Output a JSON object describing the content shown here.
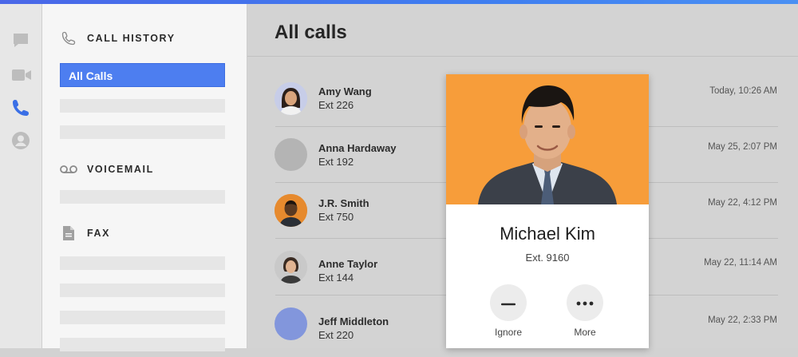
{
  "rail": {
    "icons": [
      "chat-icon",
      "video-icon",
      "phone-icon",
      "profile-icon"
    ]
  },
  "nav": {
    "call_history_title": "CALL HISTORY",
    "all_calls_label": "All Calls",
    "voicemail_title": "VOICEMAIL",
    "fax_title": "FAX"
  },
  "main": {
    "title": "All calls",
    "calls": [
      {
        "name": "Amy Wang",
        "ext": "Ext 226",
        "time": "Today, 10:26 AM"
      },
      {
        "name": "Anna Hardaway",
        "ext": "Ext 192",
        "time": "May 25, 2:07 PM"
      },
      {
        "name": "J.R. Smith",
        "ext": "Ext 750",
        "time": "May 22, 4:12 PM"
      },
      {
        "name": "Anne Taylor",
        "ext": "Ext 144",
        "time": "May 22,  11:14 AM"
      },
      {
        "name": "Jeff Middleton",
        "ext": "Ext 220",
        "time": "May 22,  2:33 PM"
      }
    ]
  },
  "incoming": {
    "name": "Michael Kim",
    "ext": "Ext. 9160",
    "ignore_label": "Ignore",
    "more_label": "More"
  },
  "colors": {
    "accent": "#4d7ef0",
    "card_photo_bg": "#f79d3a",
    "placeholder_avatar_gray": "#b4b4b4",
    "placeholder_avatar_blue": "#8296dc"
  }
}
